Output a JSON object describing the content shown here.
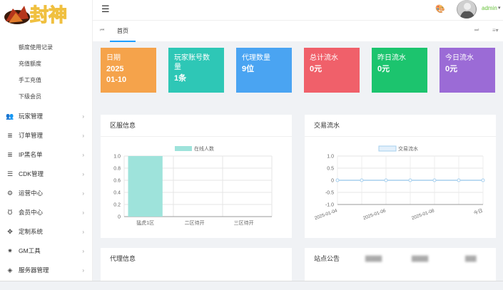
{
  "sidebar": {
    "logo_text": "封神",
    "sub_items": [
      {
        "label": "额度使用记录"
      },
      {
        "label": "充值额度"
      },
      {
        "label": "手工充值"
      },
      {
        "label": "下级会员"
      }
    ],
    "menu": [
      {
        "label": "玩家管理",
        "icon": "users-icon",
        "glyph": "👥"
      },
      {
        "label": "订单管理",
        "icon": "database-icon",
        "glyph": "≣"
      },
      {
        "label": "IP黑名单",
        "icon": "database-icon",
        "glyph": "≣"
      },
      {
        "label": "CDK管理",
        "icon": "list-icon",
        "glyph": "☰"
      },
      {
        "label": "运营中心",
        "icon": "gear-icon",
        "glyph": "⚙"
      },
      {
        "label": "会员中心",
        "icon": "magnet-icon",
        "glyph": "Ʊ"
      },
      {
        "label": "定制系统",
        "icon": "cluster-icon",
        "glyph": "✥"
      },
      {
        "label": "GM工具",
        "icon": "bulb-icon",
        "glyph": "✷"
      },
      {
        "label": "服务器管理",
        "icon": "diamond-icon",
        "glyph": "◈"
      }
    ]
  },
  "topbar": {
    "menu_icon": "☰",
    "user": "admin"
  },
  "tabs": {
    "home": "首页"
  },
  "cards": [
    {
      "label": "日期",
      "value": "2025\n01-10",
      "color": "#f5a34b"
    },
    {
      "label": "玩家账号数量",
      "value": "1条",
      "color": "#2ec7b6"
    },
    {
      "label": "代理数量",
      "value": "9位",
      "color": "#4aa4f2"
    },
    {
      "label": "总计流水",
      "value": "0元",
      "color": "#f0606a"
    },
    {
      "label": "昨日流水",
      "value": "0元",
      "color": "#1cc46e"
    },
    {
      "label": "今日流水",
      "value": "0元",
      "color": "#9b6bd6"
    }
  ],
  "panels": {
    "server": "区服信息",
    "trade": "交易流水",
    "agent": "代理信息",
    "notice": "站点公告"
  },
  "chart_data": [
    {
      "type": "bar",
      "title": "区服信息",
      "categories": [
        "猛虎1区",
        "二区待开",
        "三区待开"
      ],
      "series": [
        {
          "name": "在线人数",
          "values": [
            1,
            0,
            0
          ]
        }
      ],
      "ylim": [
        0,
        1
      ],
      "yticks": [
        "0",
        "0.2",
        "0.4",
        "0.6",
        "0.8",
        "1.0"
      ],
      "colors": [
        "#9ee3db"
      ],
      "legend": "top-center",
      "grid": true
    },
    {
      "type": "line",
      "title": "交易流水",
      "categories": [
        "2025-01-04",
        "2025-01-06",
        "2025-01-08",
        "今日"
      ],
      "series": [
        {
          "name": "交易流水",
          "values": [
            0,
            0,
            0,
            0,
            0,
            0,
            0
          ]
        }
      ],
      "ylim": [
        -1,
        1
      ],
      "yticks": [
        "-1.0",
        "-0.5",
        "0",
        "0.5",
        "1.0"
      ],
      "colors": [
        "#a6cfee"
      ],
      "legend": "top-center",
      "grid": true
    }
  ]
}
